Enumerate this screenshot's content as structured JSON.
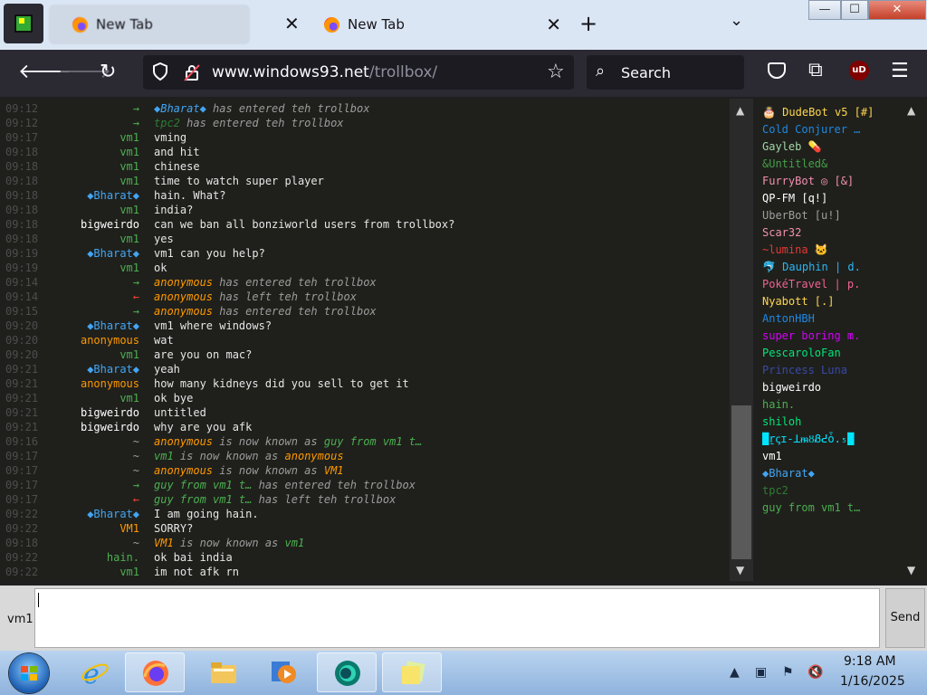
{
  "browser": {
    "tabs": [
      {
        "label": "New Tab",
        "close": "✕"
      },
      {
        "label": "New Tab",
        "close": "✕"
      }
    ],
    "new_tab": "+",
    "tab_list": "⌄",
    "window_controls": {
      "minimize": "—",
      "maximize": "☐",
      "close": "✕"
    },
    "url_host": "www.windows93.net",
    "url_path": "/trollbox/",
    "search_placeholder": "Search",
    "ublock_label": "uD",
    "icons": [
      "back-icon",
      "forward-icon",
      "reload-icon",
      "shield-icon",
      "lock-icon",
      "star-icon",
      "search-icon",
      "pocket-icon",
      "extensions-icon",
      "ublock-icon",
      "menu-icon"
    ]
  },
  "colors": {
    "nick_vm1": "#4caf50",
    "nick_bharat": "#42a5f5",
    "nick_bigweirdo": "#ffffff",
    "nick_anonymous": "#ff9800",
    "nick_VM1": "#ff9800",
    "nick_hain": "#4caf50",
    "join": "#4caf50",
    "leave": "#f44336",
    "system": "#9c9c9c"
  },
  "chat": {
    "messages": [
      {
        "time": "09:12",
        "nick": "→",
        "nick_color": "#4caf50",
        "text_parts": [
          {
            "t": "◆Bharat◆",
            "c": "#42a5f5"
          },
          {
            "t": " has entered teh trollbox",
            "c": "#9c9c9c"
          }
        ],
        "system": true
      },
      {
        "time": "09:12",
        "nick": "→",
        "nick_color": "#4caf50",
        "text_parts": [
          {
            "t": "tpc2",
            "c": "#2e7d32"
          },
          {
            "t": " has entered teh trollbox",
            "c": "#9c9c9c"
          }
        ],
        "system": true
      },
      {
        "time": "09:17",
        "nick": "vm1",
        "nick_color": "#4caf50",
        "text": "vming"
      },
      {
        "time": "09:18",
        "nick": "vm1",
        "nick_color": "#4caf50",
        "text": "and hit"
      },
      {
        "time": "09:18",
        "nick": "vm1",
        "nick_color": "#4caf50",
        "text": "chinese"
      },
      {
        "time": "09:18",
        "nick": "vm1",
        "nick_color": "#4caf50",
        "text": "time to watch super player"
      },
      {
        "time": "09:18",
        "nick": "◆Bharat◆",
        "nick_color": "#42a5f5",
        "text": "hain. What?"
      },
      {
        "time": "09:18",
        "nick": "vm1",
        "nick_color": "#4caf50",
        "text": "india?"
      },
      {
        "time": "09:18",
        "nick": "bigweirdo",
        "nick_color": "#ffffff",
        "text": "can we ban all bonziworld users from trollbox?"
      },
      {
        "time": "09:18",
        "nick": "vm1",
        "nick_color": "#4caf50",
        "text": "yes"
      },
      {
        "time": "09:19",
        "nick": "◆Bharat◆",
        "nick_color": "#42a5f5",
        "text": "vm1 can you help?"
      },
      {
        "time": "09:19",
        "nick": "vm1",
        "nick_color": "#4caf50",
        "text": "ok"
      },
      {
        "time": "09:14",
        "nick": "→",
        "nick_color": "#4caf50",
        "text_parts": [
          {
            "t": "anonymous",
            "c": "#ff9800"
          },
          {
            "t": " has entered teh trollbox",
            "c": "#9c9c9c"
          }
        ],
        "system": true
      },
      {
        "time": "09:14",
        "nick": "←",
        "nick_color": "#f44336",
        "text_parts": [
          {
            "t": "anonymous",
            "c": "#ff9800"
          },
          {
            "t": " has left teh trollbox",
            "c": "#9c9c9c"
          }
        ],
        "system": true
      },
      {
        "time": "09:15",
        "nick": "→",
        "nick_color": "#4caf50",
        "text_parts": [
          {
            "t": "anonymous",
            "c": "#ff9800"
          },
          {
            "t": " has entered teh trollbox",
            "c": "#9c9c9c"
          }
        ],
        "system": true
      },
      {
        "time": "09:20",
        "nick": "◆Bharat◆",
        "nick_color": "#42a5f5",
        "text": "vm1 where windows?"
      },
      {
        "time": "09:20",
        "nick": "anonymous",
        "nick_color": "#ff9800",
        "text": "wat"
      },
      {
        "time": "09:20",
        "nick": "vm1",
        "nick_color": "#4caf50",
        "text": "are you on mac?"
      },
      {
        "time": "09:21",
        "nick": "◆Bharat◆",
        "nick_color": "#42a5f5",
        "text": "yeah"
      },
      {
        "time": "09:21",
        "nick": "anonymous",
        "nick_color": "#ff9800",
        "text": "how many kidneys did you sell to get it"
      },
      {
        "time": "09:21",
        "nick": "vm1",
        "nick_color": "#4caf50",
        "text": "ok bye"
      },
      {
        "time": "09:21",
        "nick": "bigweirdo",
        "nick_color": "#ffffff",
        "text": "untitled"
      },
      {
        "time": "09:21",
        "nick": "bigweirdo",
        "nick_color": "#ffffff",
        "text": "why are you afk"
      },
      {
        "time": "09:16",
        "nick": "~",
        "nick_color": "#9c9c9c",
        "text_parts": [
          {
            "t": "anonymous",
            "c": "#ff9800"
          },
          {
            "t": " is now known as ",
            "c": "#9c9c9c"
          },
          {
            "t": "guy from vm1 t…",
            "c": "#4caf50"
          }
        ],
        "system": true
      },
      {
        "time": "09:17",
        "nick": "~",
        "nick_color": "#9c9c9c",
        "text_parts": [
          {
            "t": "vm1",
            "c": "#4caf50"
          },
          {
            "t": " is now known as ",
            "c": "#9c9c9c"
          },
          {
            "t": "anonymous",
            "c": "#ff9800"
          }
        ],
        "system": true
      },
      {
        "time": "09:17",
        "nick": "~",
        "nick_color": "#9c9c9c",
        "text_parts": [
          {
            "t": "anonymous",
            "c": "#ff9800"
          },
          {
            "t": " is now known as ",
            "c": "#9c9c9c"
          },
          {
            "t": "VM1",
            "c": "#ff9800"
          }
        ],
        "system": true
      },
      {
        "time": "09:17",
        "nick": "→",
        "nick_color": "#4caf50",
        "text_parts": [
          {
            "t": "guy from vm1 t…",
            "c": "#4caf50"
          },
          {
            "t": " has entered teh trollbox",
            "c": "#9c9c9c"
          }
        ],
        "system": true
      },
      {
        "time": "09:17",
        "nick": "←",
        "nick_color": "#f44336",
        "text_parts": [
          {
            "t": "guy from vm1 t…",
            "c": "#4caf50"
          },
          {
            "t": " has left teh trollbox",
            "c": "#9c9c9c"
          }
        ],
        "system": true
      },
      {
        "time": "09:22",
        "nick": "◆Bharat◆",
        "nick_color": "#42a5f5",
        "text": "I am going hain."
      },
      {
        "time": "09:22",
        "nick": "VM1",
        "nick_color": "#ff9800",
        "text": "SORRY?"
      },
      {
        "time": "09:18",
        "nick": "~",
        "nick_color": "#9c9c9c",
        "text_parts": [
          {
            "t": "VM1",
            "c": "#ff9800"
          },
          {
            "t": " is now known as ",
            "c": "#9c9c9c"
          },
          {
            "t": "vm1",
            "c": "#4caf50"
          }
        ],
        "system": true
      },
      {
        "time": "09:22",
        "nick": "hain.",
        "nick_color": "#4caf50",
        "text": "ok bai india"
      },
      {
        "time": "09:22",
        "nick": "vm1",
        "nick_color": "#4caf50",
        "text": "im not afk rn"
      }
    ]
  },
  "users": [
    {
      "name": "🎂 DudeBot v5 [#]",
      "color": "#ffd54f"
    },
    {
      "name": "Cold Conjurer …",
      "color": "#1e88e5"
    },
    {
      "name": "Gayleb 💊",
      "color": "#a5d6a7"
    },
    {
      "name": "&Untitled&",
      "color": "#43a047"
    },
    {
      "name": "FurryBot ◎ [&]",
      "color": "#f48fb1"
    },
    {
      "name": "QP-FM [q!]",
      "color": "#ffffff"
    },
    {
      "name": "UberBot [u!]",
      "color": "#9e9e9e"
    },
    {
      "name": "Scar32",
      "color": "#f48fb1"
    },
    {
      "name": "~lumina 🐱",
      "color": "#e53935"
    },
    {
      "name": "🐬 Dauphin | d.",
      "color": "#29b6f6"
    },
    {
      "name": "PokéTravel | p.",
      "color": "#f06292"
    },
    {
      "name": "Nyabott [.]",
      "color": "#ffd54f"
    },
    {
      "name": "AntonHBH",
      "color": "#1e88e5"
    },
    {
      "name": "super boring m.",
      "color": "#d500f9"
    },
    {
      "name": "PescaroloFan",
      "color": "#00e676"
    },
    {
      "name": "Princess Luna",
      "color": "#3949ab"
    },
    {
      "name": "bigweirdo",
      "color": "#ffffff"
    },
    {
      "name": "hain.",
      "color": "#4caf50"
    },
    {
      "name": "shiloh",
      "color": "#00e676"
    },
    {
      "name": "█ṟꞔɪ-ꓕᵯȣᏰᕍȱ.₅█",
      "color": "#00e5ff"
    },
    {
      "name": "vm1",
      "color": "#ffffff"
    },
    {
      "name": "◆Bharat◆",
      "color": "#42a5f5"
    },
    {
      "name": "tpc2",
      "color": "#2e7d32"
    },
    {
      "name": "guy from vm1 t…",
      "color": "#4caf50"
    }
  ],
  "composer": {
    "nick": "vm1",
    "value": "",
    "send_label": "Send"
  },
  "taskbar": {
    "items": [
      "start-button",
      "internet-explorer",
      "firefox",
      "file-explorer",
      "media-player",
      "app-green",
      "notes"
    ],
    "clock_time": "9:18 AM",
    "clock_date": "1/16/2025"
  }
}
